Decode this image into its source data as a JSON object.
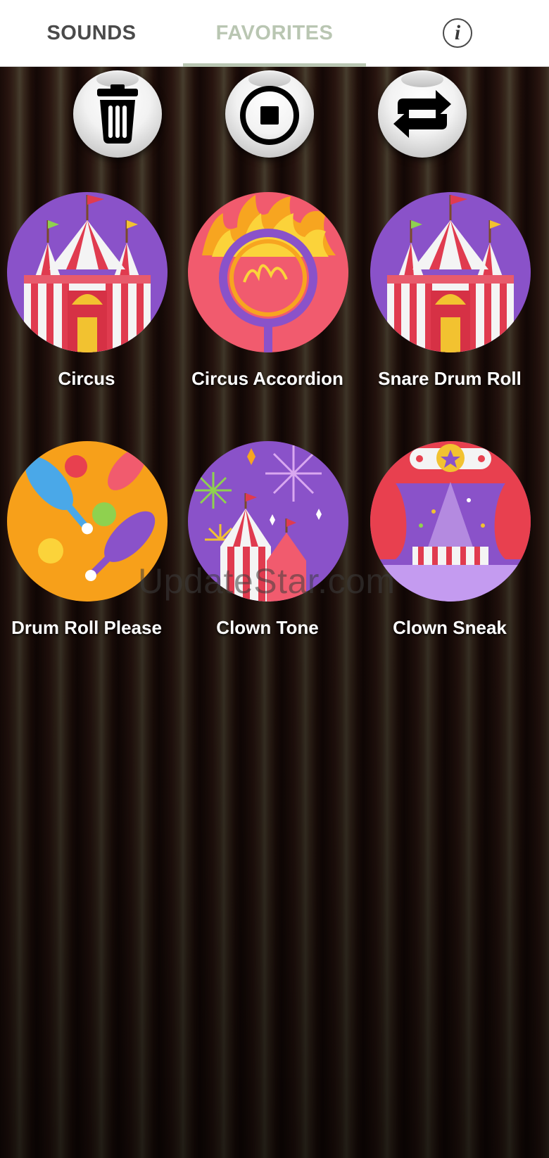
{
  "tabs": [
    {
      "label": "SOUNDS",
      "selected": false
    },
    {
      "label": "FAVORITES",
      "selected": true
    }
  ],
  "info_button": {
    "glyph": "i",
    "icon": "info-icon"
  },
  "controls": [
    {
      "name": "delete",
      "icon": "trash-icon"
    },
    {
      "name": "stop",
      "icon": "stop-icon"
    },
    {
      "name": "repeat",
      "icon": "repeat-icon"
    }
  ],
  "sounds": [
    {
      "label": "Circus",
      "icon": "circus-tent-icon"
    },
    {
      "label": "Circus Accordion",
      "icon": "fire-hoop-icon"
    },
    {
      "label": "Snare Drum Roll",
      "icon": "circus-tent-icon"
    },
    {
      "label": "Drum Roll Please",
      "icon": "juggling-pins-icon"
    },
    {
      "label": "Clown Tone",
      "icon": "fireworks-tent-icon"
    },
    {
      "label": "Clown Sneak",
      "icon": "stage-curtain-icon"
    }
  ],
  "watermark": "UpdateStar.com",
  "colors": {
    "tab_active": "#b9c6b2",
    "tab_inactive": "#4a4a4a",
    "label_text": "#ffffff"
  }
}
